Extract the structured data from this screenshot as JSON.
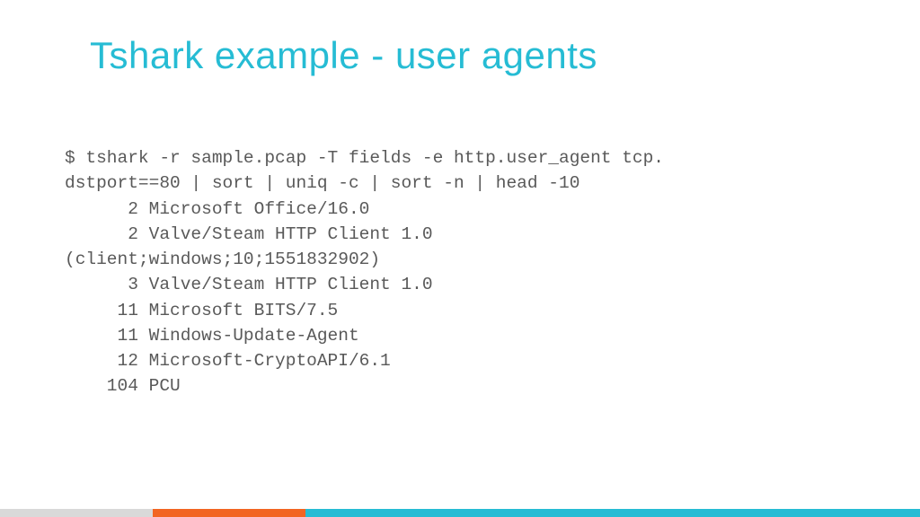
{
  "title": "Tshark example - user agents",
  "command": "$ tshark -r sample.pcap -T fields -e http.user_agent tcp.\ndstport==80 | sort | uniq -c | sort -n | head -10",
  "output_lines": [
    "      2 Microsoft Office/16.0",
    "      2 Valve/Steam HTTP Client 1.0",
    "(client;windows;10;1551832902)",
    "      3 Valve/Steam HTTP Client 1.0",
    "     11 Microsoft BITS/7.5",
    "     11 Windows-Update-Agent",
    "     12 Microsoft-CryptoAPI/6.1",
    "    104 PCU"
  ],
  "colors": {
    "title": "#26bcd4",
    "text": "#595959",
    "bar_grey": "#d9d9d9",
    "bar_orange": "#f26522",
    "bar_teal": "#26bcd4"
  }
}
